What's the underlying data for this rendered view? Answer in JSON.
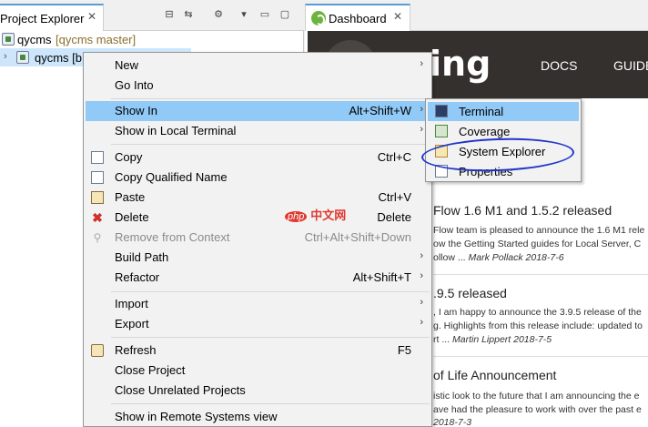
{
  "project_explorer": {
    "tab_title": "Project Explorer",
    "close_glyph": "✕",
    "tree": [
      {
        "label": "qycms",
        "decoration": "[qycms master]"
      },
      {
        "label": "qycms [b"
      }
    ]
  },
  "dashboard": {
    "tab_title": "Dashboard",
    "close_glyph": "✕",
    "nav_brand": "ing",
    "nav_links": [
      "DOCS",
      "GUIDE"
    ],
    "news": [
      {
        "title": "Flow 1.6 M1 and 1.5.2 released",
        "lines": [
          "Flow team is pleased to announce the 1.6 M1 rele",
          "ow the Getting Started guides for Local Server, C"
        ],
        "tail": "ollow ... ",
        "byline": "Mark Pollack 2018-7-6"
      },
      {
        "title": ".9.5 released",
        "lines": [
          ", I am happy to announce the 3.9.5 release of the",
          "g. Highlights from this release include: updated to"
        ],
        "tail": "rt ... ",
        "byline": "Martin Lippert 2018-7-5"
      },
      {
        "title": "of Life Announcement",
        "lines": [
          "istic look to the future that I am announcing the e",
          "ave had the pleasure to work with over the past e"
        ],
        "tail": "",
        "byline": "2018-7-3"
      }
    ]
  },
  "context_menu": {
    "items": [
      {
        "label": "New",
        "accel": "",
        "submenu": true
      },
      {
        "label": "Go Into",
        "accel": "",
        "submenu": false
      },
      {
        "label": "Show In",
        "accel": "Alt+Shift+W",
        "submenu": true
      },
      {
        "label": "Show in Local Terminal",
        "accel": "",
        "submenu": true
      },
      {
        "label": "Copy",
        "accel": "Ctrl+C",
        "submenu": false
      },
      {
        "label": "Copy Qualified Name",
        "accel": "",
        "submenu": false
      },
      {
        "label": "Paste",
        "accel": "Ctrl+V",
        "submenu": false
      },
      {
        "label": "Delete",
        "accel": "Delete",
        "submenu": false
      },
      {
        "label": "Remove from Context",
        "accel": "Ctrl+Alt+Shift+Down",
        "submenu": false
      },
      {
        "label": "Build Path",
        "accel": "",
        "submenu": true
      },
      {
        "label": "Refactor",
        "accel": "Alt+Shift+T",
        "submenu": true
      },
      {
        "label": "Import",
        "accel": "",
        "submenu": true
      },
      {
        "label": "Export",
        "accel": "",
        "submenu": true
      },
      {
        "label": "Refresh",
        "accel": "F5",
        "submenu": false
      },
      {
        "label": "Close Project",
        "accel": "",
        "submenu": false
      },
      {
        "label": "Close Unrelated Projects",
        "accel": "",
        "submenu": false
      },
      {
        "label": "Show in Remote Systems view",
        "accel": "",
        "submenu": false
      }
    ],
    "submenu_arrow": "›"
  },
  "show_in_submenu": {
    "items": [
      "Terminal",
      "Coverage",
      "System Explorer",
      "Properties"
    ]
  },
  "watermark": {
    "badge": "php",
    "text": "中文网"
  },
  "colors": {
    "selection": "#91c9f7",
    "annotation": "#2035c8",
    "nav_bg": "#34302d"
  }
}
